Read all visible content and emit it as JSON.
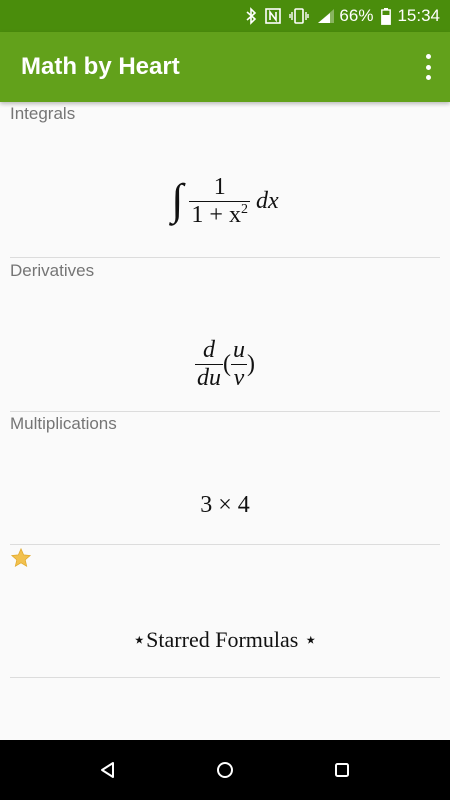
{
  "status_bar": {
    "battery": "66%",
    "time": "15:34"
  },
  "app_bar": {
    "title": "Math by Heart"
  },
  "sections": {
    "integrals": {
      "header": "Integrals",
      "numerator": "1",
      "denominator": "1 + x",
      "exponent": "2",
      "suffix": "dx"
    },
    "derivatives": {
      "header": "Derivatives",
      "d_num": "d",
      "d_den": "du",
      "u": "u",
      "v": "v"
    },
    "multiplications": {
      "header": "Multiplications",
      "formula": "3 × 4"
    },
    "starred": {
      "formula": "⋆Starred Formulas ⋆"
    }
  },
  "colors": {
    "status_bar": "#4a8d0c",
    "app_bar": "#62a11b",
    "star": "#f2c14e"
  }
}
